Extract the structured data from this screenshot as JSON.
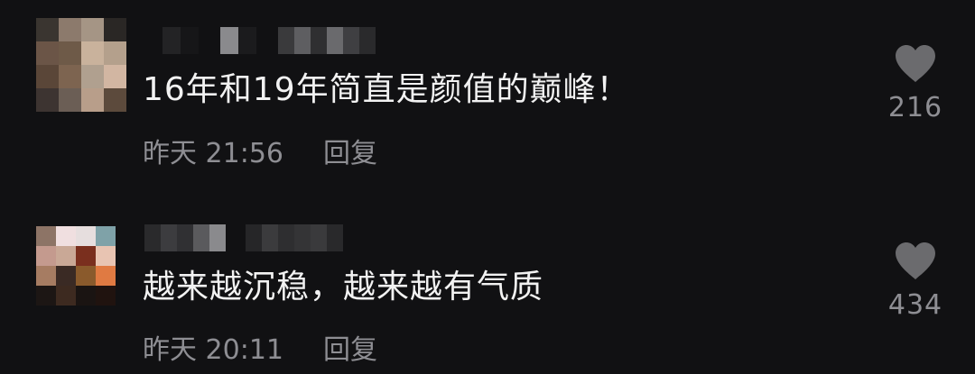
{
  "comments": [
    {
      "text": "16年和19年简直是颜值的巅峰！",
      "timestamp": "昨天 21:56",
      "reply_label": "回复",
      "like_count": "216",
      "avatar_icon": "pixelated-avatar"
    },
    {
      "text": "越来越沉稳，越来越有气质",
      "timestamp": "昨天 20:11",
      "reply_label": "回复",
      "like_count": "434",
      "avatar_icon": "pixelated-avatar"
    }
  ],
  "colors": {
    "background": "#111113",
    "text_primary": "#f2f2f2",
    "text_secondary": "#8e8e93",
    "heart": "#6b6b6e"
  }
}
